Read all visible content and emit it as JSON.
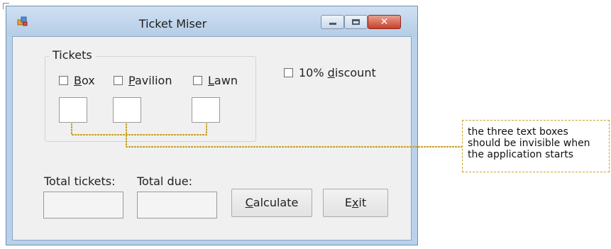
{
  "window": {
    "title": "Ticket Miser",
    "close_glyph": "✕"
  },
  "tickets_group": {
    "label": "Tickets",
    "checkboxes": [
      {
        "accel": "B",
        "rest": "ox"
      },
      {
        "accel": "P",
        "rest": "avilion"
      },
      {
        "accel": "L",
        "rest": "awn"
      }
    ]
  },
  "discount": {
    "pre": "10% ",
    "accel": "d",
    "rest": "iscount"
  },
  "totals": {
    "tickets_label": "Total tickets:",
    "due_label": "Total due:"
  },
  "buttons": {
    "calculate": {
      "accel": "C",
      "rest": "alculate"
    },
    "exit": {
      "pre": "E",
      "accel": "x",
      "rest": "it"
    }
  },
  "callout": {
    "lines": [
      "the three text boxes",
      "should be invisible when",
      "the application starts"
    ]
  },
  "colors": {
    "window_border": "#6f8fb3",
    "titlebar": "#b9d1ea",
    "client": "#f0f0f0",
    "callout_line": "#c9a227",
    "close_button": "#c7412b"
  },
  "icons": [
    "app-icon",
    "minimize-icon",
    "maximize-icon",
    "close-icon"
  ]
}
